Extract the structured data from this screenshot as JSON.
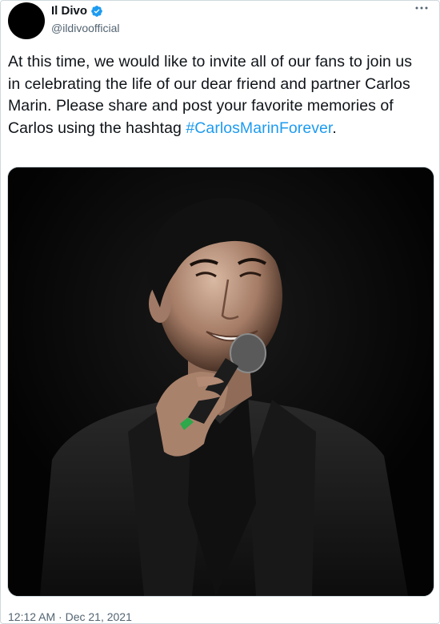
{
  "tweet": {
    "display_name": "Il Divo",
    "handle": "@ildivoofficial",
    "verified": true,
    "text_before_hashtag": "At this time, we would like to invite all of our fans to join us in celebrating the life of our dear friend and partner Carlos Marin. Please share and post your favorite memories of Carlos using the hashtag ",
    "hashtag": "#CarlosMarinForever",
    "text_after_hashtag": ".",
    "timestamp": "12:12 AM · Dec 21, 2021",
    "more_icon": "more-horizontal-icon",
    "verified_icon": "verified-badge-icon"
  },
  "colors": {
    "link": "#1d9bf0",
    "text": "#0f1419",
    "secondary_text": "#536471",
    "border": "#cfd9de"
  }
}
